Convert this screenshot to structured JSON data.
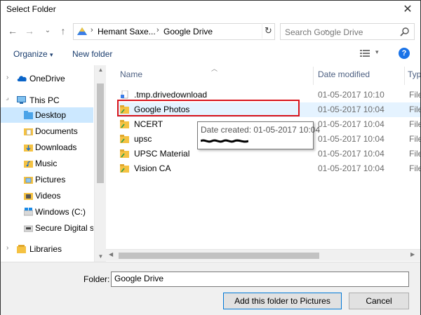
{
  "window": {
    "title": "Select Folder",
    "close_glyph": "✕"
  },
  "nav": {
    "back_glyph": "←",
    "forward_glyph": "→",
    "recent_glyph": "⌄",
    "up_glyph": "↑",
    "breadcrumb": [
      "Hemant Saxe...",
      "Google Drive"
    ],
    "crumb_sep": "›",
    "dropdown_glyph": "⌄",
    "refresh_glyph": "↻"
  },
  "search": {
    "placeholder": "Search Google Drive"
  },
  "toolbar": {
    "organize": "Organize",
    "organize_caret": "▾",
    "new_folder": "New folder",
    "view_caret": "▾",
    "help": "?"
  },
  "sidebar": {
    "items": [
      {
        "label": "OneDrive",
        "icon": "cloud-icon"
      },
      {
        "label": "This PC",
        "icon": "pc-icon"
      },
      {
        "label": "Desktop",
        "icon": "folder-icon",
        "selected": true
      },
      {
        "label": "Documents",
        "icon": "documents-icon"
      },
      {
        "label": "Downloads",
        "icon": "downloads-icon"
      },
      {
        "label": "Music",
        "icon": "music-icon"
      },
      {
        "label": "Pictures",
        "icon": "pictures-icon"
      },
      {
        "label": "Videos",
        "icon": "videos-icon"
      },
      {
        "label": "Windows (C:)",
        "icon": "drive-icon"
      },
      {
        "label": "Secure Digital sto",
        "icon": "sd-card-icon"
      },
      {
        "label": "Libraries",
        "icon": "libraries-icon"
      }
    ],
    "expander_glyph": "›"
  },
  "columns": {
    "name": "Name",
    "date_modified": "Date modified",
    "type": "Typ"
  },
  "files": [
    {
      "name": ".tmp.drivedownload",
      "date": "01-05-2017 10:10",
      "type": "File"
    },
    {
      "name": "Google Photos",
      "date": "01-05-2017 10:04",
      "type": "File"
    },
    {
      "name": "NCERT",
      "date": "01-05-2017 10:04",
      "type": "File"
    },
    {
      "name": "upsc",
      "date": "01-05-2017 10:04",
      "type": "File"
    },
    {
      "name": "UPSC Material",
      "date": "01-05-2017 10:04",
      "type": "File"
    },
    {
      "name": "Vision CA",
      "date": "01-05-2017 10:04",
      "type": "File"
    }
  ],
  "tooltip": {
    "line1": "Date created: 01-05-2017 10:04"
  },
  "scroll": {
    "up": "▲",
    "down": "▼",
    "left": "◀",
    "right": "▶"
  },
  "footer": {
    "folder_label": "Folder:",
    "folder_value": "Google Drive",
    "add_button": "Add this folder to Pictures",
    "cancel_button": "Cancel"
  },
  "colors": {
    "accent": "#0078d7",
    "highlight": "#d9141b",
    "selected": "#cce8ff",
    "hover": "#e5f3ff",
    "folder": "#f5c242"
  }
}
